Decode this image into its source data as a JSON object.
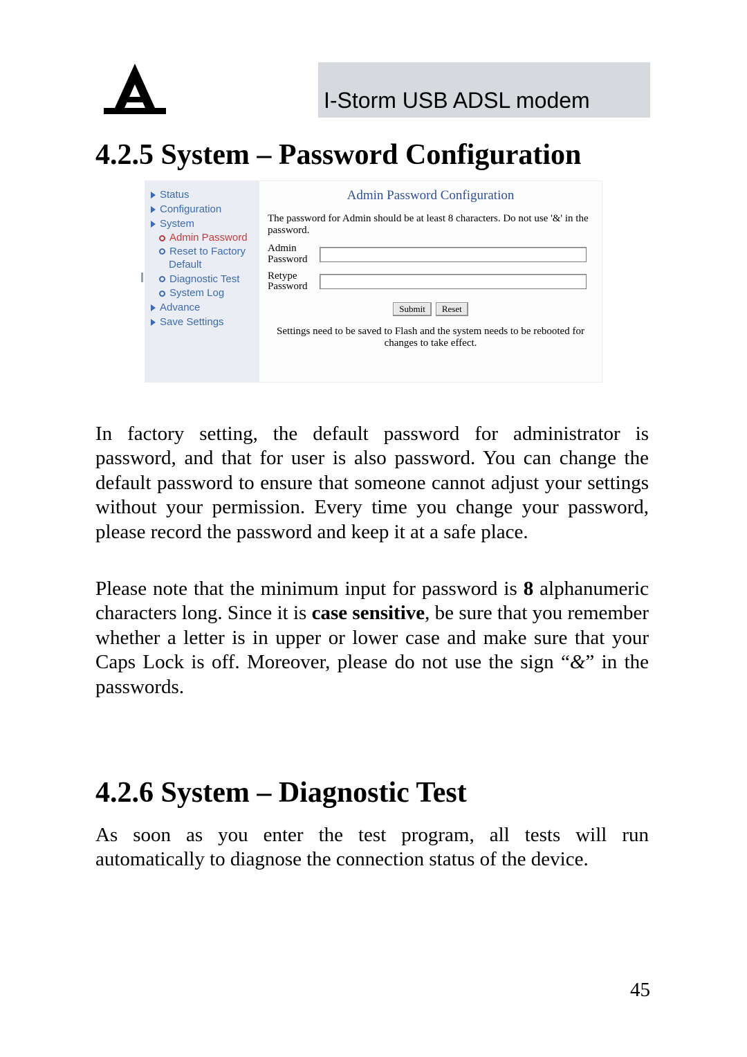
{
  "header": {
    "product_name": "I-Storm USB ADSL modem",
    "logo_alt": "A-logo"
  },
  "headings": {
    "h1": "4.2.5 System – Password Configuration",
    "h2": "4.2.6 System – Diagnostic Test"
  },
  "sidebar": {
    "status": "Status",
    "configuration": "Configuration",
    "system": "System",
    "admin_password": "Admin Password",
    "reset_line1": "Reset to Factory",
    "reset_line2": "Default",
    "diagnostic": "Diagnostic Test",
    "system_log": "System Log",
    "advance": "Advance",
    "save_settings": "Save Settings"
  },
  "panel": {
    "title": "Admin Password Configuration",
    "hint": "The password for Admin should be at least 8 characters. Do not use '&' in the password.",
    "label_admin": "Admin Password",
    "label_retype": "Retype Password",
    "submit": "Submit",
    "reset": "Reset",
    "footer": "Settings need to be saved to Flash and the system needs to be rebooted for changes to take effect."
  },
  "paragraphs": {
    "p1": "In factory setting, the default password for administrator is password, and that for user is also password. You can change the default password to ensure that someone cannot adjust your settings without your permission. Every time you change your password, please record the password and keep it at a safe place.",
    "p2_a": "Please note that the minimum input for password is ",
    "p2_8": "8",
    "p2_b": " alphanumeric characters long. Since it is ",
    "p2_cs": "case sensitive",
    "p2_c": ", be sure that you remember whether a letter is in upper or lower case and make sure that your Caps Lock is off. Moreover, please do not use the sign “",
    "p2_amp": "&",
    "p2_d": "” in the passwords.",
    "p3": "As soon as you enter the test program, all tests will run automatically to diagnose the connection status of the device."
  },
  "page_number": "45"
}
